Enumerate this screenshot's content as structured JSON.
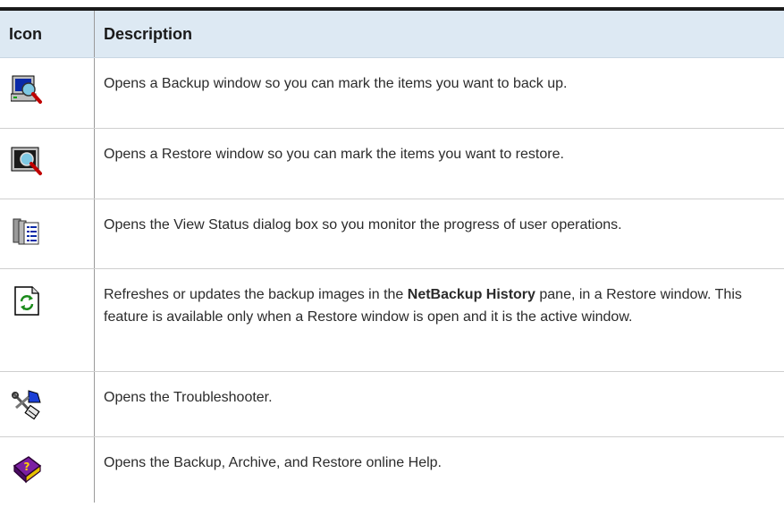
{
  "table": {
    "header": {
      "icon": "Icon",
      "description": "Description"
    },
    "rows": [
      {
        "icon": "backup-computer-magnifier-icon",
        "text": "Opens a Backup window so you can mark the items you want to back up."
      },
      {
        "icon": "restore-monitor-magnifier-icon",
        "text": "Opens a Restore window so you can mark the items you want to restore."
      },
      {
        "icon": "view-status-list-icon",
        "text": "Opens the View Status dialog box so you monitor the progress of user operations."
      },
      {
        "icon": "refresh-document-icon",
        "parts": {
          "before": "Refreshes or updates the backup images in the ",
          "bold": "NetBackup History",
          "after": " pane, in a Restore window. This feature is available only when a Restore window is open and it is the active window."
        }
      },
      {
        "icon": "troubleshooter-tools-icon",
        "text": "Opens the Troubleshooter."
      },
      {
        "icon": "help-book-icon",
        "text": "Opens the Backup, Archive, and Restore online Help."
      }
    ]
  }
}
